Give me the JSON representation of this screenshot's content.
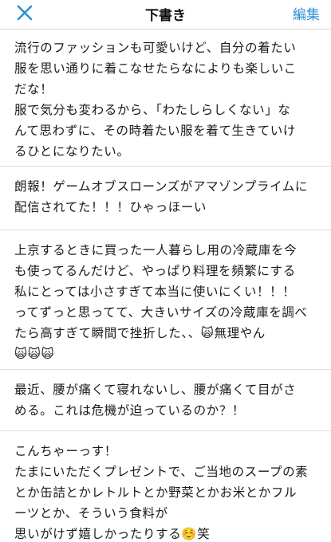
{
  "navbar": {
    "title": "下書き",
    "edit_label": "編集",
    "close_icon": "close-x-icon",
    "accent_color": "#2e8fd4"
  },
  "drafts": [
    {
      "text": "流行のファッションも可愛いけど、自分の着たい\n服を思い通りに着こなせたらなによりも楽しいこ\nだな！\n服で気分も変わるから、「わたしらしくない」な\nんて思わずに、その時着たい服を着て生きていけ\nるひとになりたい。"
    },
    {
      "text": "朗報！ゲームオブスローンズがアマゾンプライムに\n配信されてた！！！ひゃっほーい"
    },
    {
      "text": "上京するときに買った一人暮らし用の冷蔵庫を今\nも使ってるんだけど、やっぱり料理を頻繁にする\n私にとっては小さすぎて本当に使いにくい！！！\nってずっと思ってて、大きいサイズの冷蔵庫を調べ\nたら高すぎて瞬間で挫折した、、🙀無理やん\n🙀🙀🙀"
    },
    {
      "text": "最近、腰が痛くて寝れないし、腰が痛くて目がさ\nめる。これは危機が迫っているのか？！"
    },
    {
      "text": "こんちゃーっす！\nたまにいただくプレゼントで、ご当地のスープの素\nとか缶詰とかレトルトとか野菜とかお米とかフル\nーツとか、そういう食料が\n思いがけず嬉しかったりする☺️笑"
    }
  ]
}
